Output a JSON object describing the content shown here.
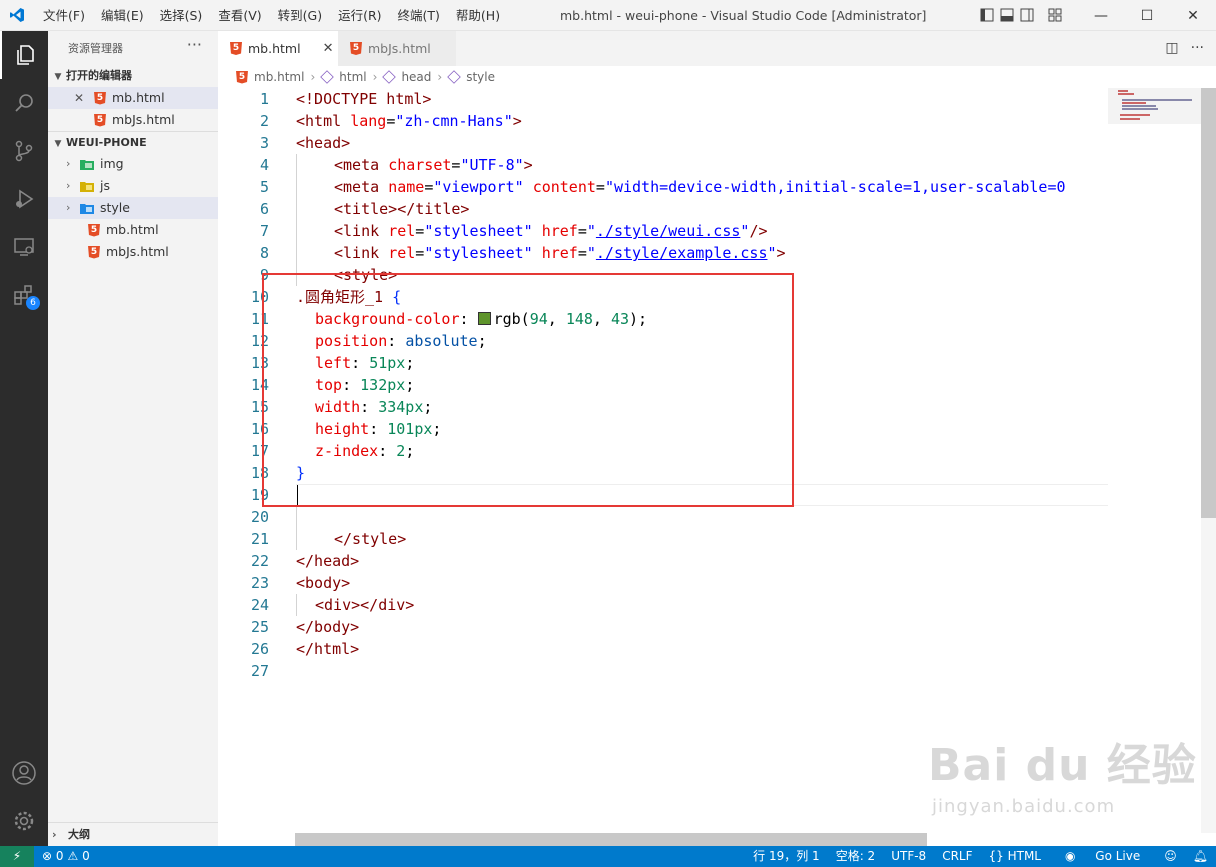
{
  "titlebar": {
    "menus": [
      "文件(F)",
      "编辑(E)",
      "选择(S)",
      "查看(V)",
      "转到(G)",
      "运行(R)",
      "终端(T)",
      "帮助(H)"
    ],
    "title": "mb.html - weui-phone - Visual Studio Code [Administrator]",
    "minimize": "—",
    "maximize": "☐",
    "close": "✕"
  },
  "activity": {
    "extensions_badge": "6"
  },
  "sidebar": {
    "title": "资源管理器",
    "more": "···",
    "open_editors_label": "打开的编辑器",
    "open_editors": [
      {
        "name": "mb.html",
        "close": "✕"
      },
      {
        "name": "mbJs.html"
      }
    ],
    "project_label": "WEUI-PHONE",
    "tree": [
      {
        "name": "img",
        "kind": "folder"
      },
      {
        "name": "js",
        "kind": "folder"
      },
      {
        "name": "style",
        "kind": "folder"
      },
      {
        "name": "mb.html",
        "kind": "html"
      },
      {
        "name": "mbJs.html",
        "kind": "html"
      }
    ],
    "outline_label": "大纲"
  },
  "tabs": [
    {
      "label": "mb.html",
      "close": "✕"
    },
    {
      "label": "mbJs.html"
    }
  ],
  "tab_actions": {
    "split": "◫",
    "more": "···"
  },
  "breadcrumb": [
    "mb.html",
    "html",
    "head",
    "style"
  ],
  "editor": {
    "line_numbers": [
      "1",
      "2",
      "3",
      "4",
      "5",
      "6",
      "7",
      "8",
      "9",
      "10",
      "11",
      "12",
      "13",
      "14",
      "15",
      "16",
      "17",
      "18",
      "19",
      "20",
      "21",
      "22",
      "23",
      "24",
      "25",
      "26",
      "27"
    ],
    "doctype": "<!DOCTYPE html>",
    "html_open": "html",
    "lang_attr": "lang",
    "lang_val": "\"zh-cmn-Hans\"",
    "head_open": "<head>",
    "meta_charset_attr": "charset",
    "meta_charset_val": "\"UTF-8\"",
    "meta_name_attr": "name",
    "meta_name_val": "\"viewport\"",
    "meta_content_attr": "content",
    "meta_content_val": "\"width=device-width,initial-scale=1,user-scalable=0",
    "title_tag": "<title></title>",
    "link_rel_val": "\"stylesheet\"",
    "link1_href": "./style/weui.css",
    "link2_href": "./style/example.css",
    "style_open": "<style>",
    "selector": ".圆角矩形_1",
    "props": [
      {
        "name": "background-color",
        "value": "rgb(94, 148, 43)",
        "swatch": "#5e942b"
      },
      {
        "name": "position",
        "value": "absolute"
      },
      {
        "name": "left",
        "value": "51px"
      },
      {
        "name": "top",
        "value": "132px"
      },
      {
        "name": "width",
        "value": "334px"
      },
      {
        "name": "height",
        "value": "101px"
      },
      {
        "name": "z-index",
        "value": "2"
      }
    ],
    "close_brace": "}",
    "style_close": "</style>",
    "head_close": "</head>",
    "body_open": "<body>",
    "div": "<div></div>",
    "body_close": "</body>",
    "html_close": "</html>"
  },
  "statusbar": {
    "remote": "⚡",
    "errors": "⊗ 0",
    "warnings": "⚠ 0",
    "position": "行 19，列 1",
    "indent": "空格: 2",
    "encoding": "UTF-8",
    "eol": "CRLF",
    "language": "{} HTML",
    "golive": "Go Live"
  },
  "watermark": {
    "brand": "Bai du 经验",
    "url": "jingyan.baidu.com"
  }
}
